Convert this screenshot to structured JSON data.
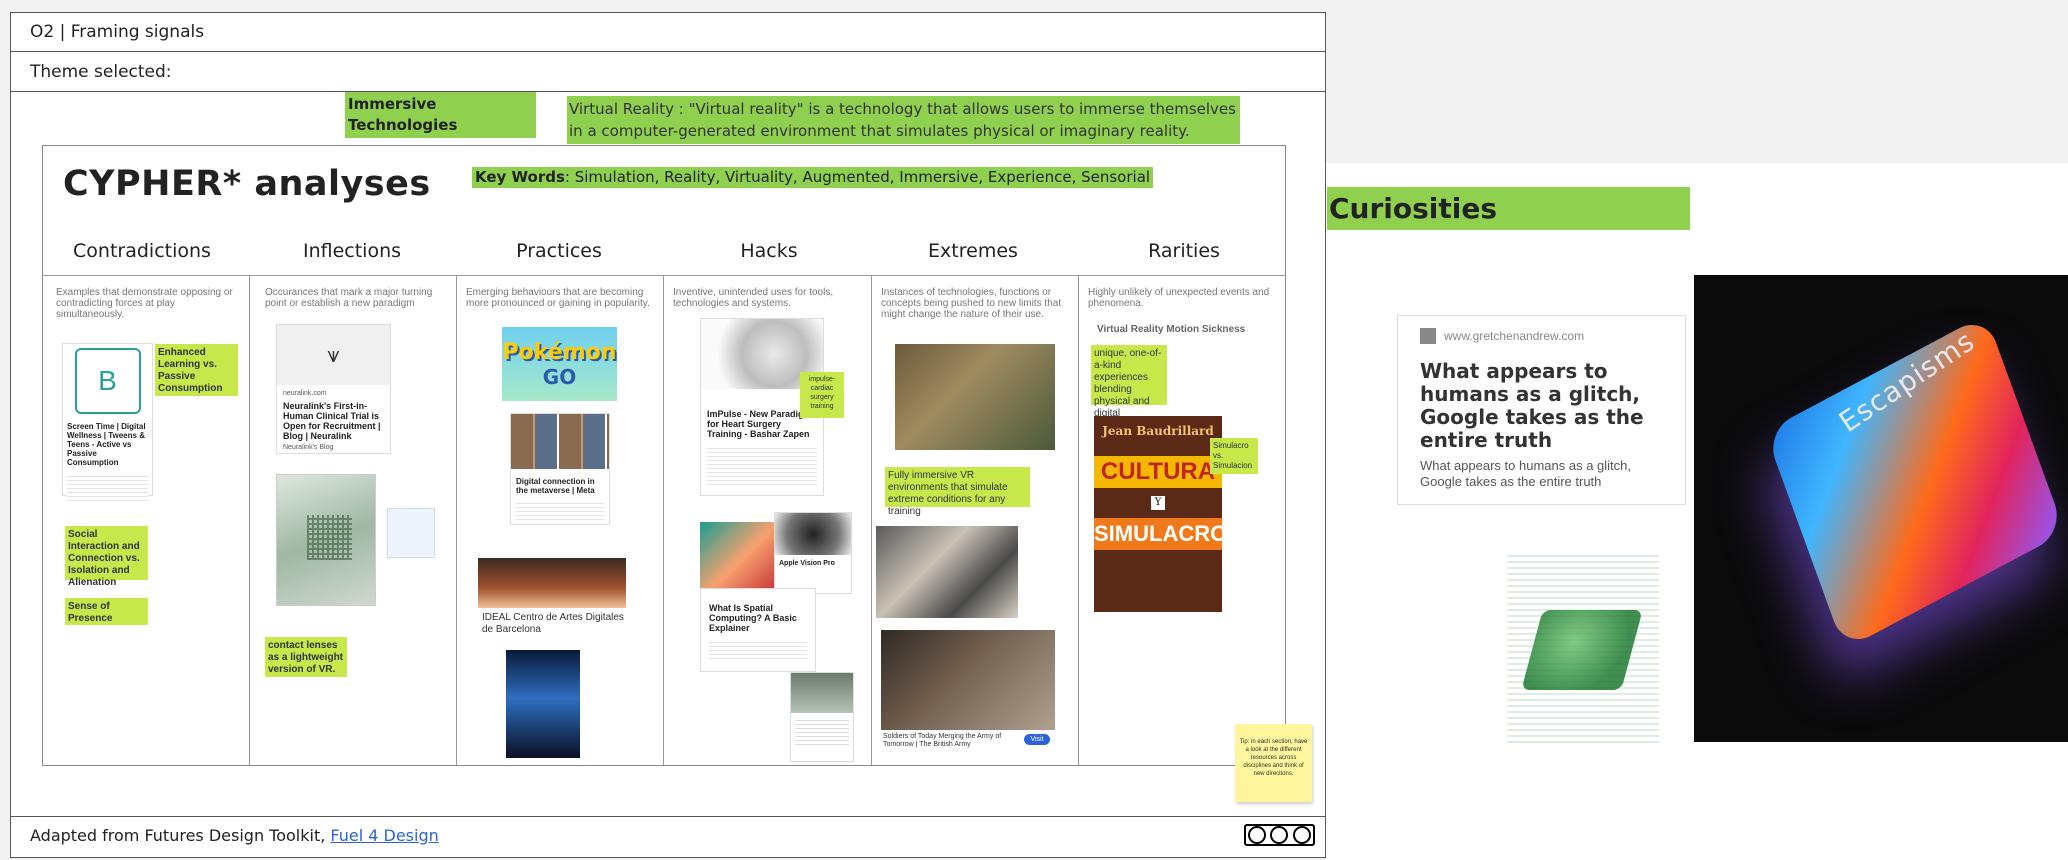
{
  "header": {
    "section_title": "O2 | Framing signals",
    "theme_label": "Theme selected:"
  },
  "theme": {
    "name": "Immersive Technologies",
    "definition": "Virtual Reality : \"Virtual reality\" is a technology that allows users to immerse themselves in a computer-generated environment that simulates physical or imaginary reality.",
    "keywords_label": "Key Words",
    "keywords": ": Simulation, Reality, Virtuality, Augmented, Immersive, Experience, Sensorial"
  },
  "board": {
    "title": "CYPHER* analyses",
    "columns": [
      {
        "name": "Contradictions",
        "desc": "Examples that demonstrate opposing or contradicting forces at play simultaneously."
      },
      {
        "name": "Inflections",
        "desc": "Occurances that mark a major turning point or establish a new paradigm"
      },
      {
        "name": "Practices",
        "desc": "Emerging behaviours that are becoming more pronounced or gaining in popularity."
      },
      {
        "name": "Hacks",
        "desc": "Inventive, unintended uses for tools, technologies and systems."
      },
      {
        "name": "Extremes",
        "desc": "Instances of technologies, functions or concepts being pushed to new limits that might change the nature of their use."
      },
      {
        "name": "Rarities",
        "desc": "Highly unlikely of unexpected events and phenomena."
      }
    ],
    "contradictions": {
      "card_title": "Screen Time | Digital Wellness | Tweens & Teens - Active vs Passive Consumption",
      "sticky1": "Enhanced Learning vs. Passive Consumption",
      "sticky2": "Social Interaction and Connection vs. Isolation and Alienation",
      "sticky3": "Sense of Presence"
    },
    "inflections": {
      "card_title": "Neuralink's First-in-Human Clinical Trial is Open for Recruitment | Blog | Neuralink",
      "card_source": "neuralink.com",
      "card_sub": "Neuralink's Blog",
      "sticky": "contact lenses as a lightweight version of VR."
    },
    "practices": {
      "pokemon_top": "Pokémon",
      "pokemon_bottom": "GO",
      "card_title": "Digital connection in the metaverse | Meta",
      "caption": "IDEAL Centro de Artes Digitales de Barcelona"
    },
    "hacks": {
      "card1_title": "ImPulse - New Paradigm for Heart Surgery Training - Bashar Zapen",
      "sticky": "impulse- cardiac surgery training",
      "card2_title": "Apple Vision Pro",
      "card3_title": "What Is Spatial Computing? A Basic Explainer"
    },
    "extremes": {
      "sticky": "Fully immersive VR environments that simulate extreme conditions for any training",
      "caption": "Soldiers of Today Merging the Army of Tomorrow | The British Army",
      "button": "Visit"
    },
    "rarities": {
      "heading": "Virtual Reality Motion Sickness",
      "sticky1": "unique, one-of-a-kind experiences blending physical and digital elements.",
      "sticky2": "Simulacro vs. Simulacion",
      "book_author": "Jean Baudrillard",
      "book_title1": "CULTURA",
      "book_y": "Y",
      "book_title2": "SIMULACRO"
    },
    "tip": "Tip: in each section, have a look at the different resources across disciplines and think of new directions."
  },
  "footer": {
    "text": "Adapted from Futures Design Toolkit, ",
    "link": "Fuel 4 Design",
    "license": "CC BY SA"
  },
  "curiosities": {
    "title": "Curiosities",
    "card_source": "www.gretchenandrew.com",
    "card_title": "What appears to humans as a glitch, Google takes as the entire truth",
    "card_sub": "What appears to humans as a glitch, Google takes as the entire truth",
    "key_label": "Escapisms"
  },
  "colors": {
    "green": "#8fd14f",
    "lime": "#c6e84a",
    "sticky_yellow": "#fff59d",
    "link": "#2b63d9"
  }
}
